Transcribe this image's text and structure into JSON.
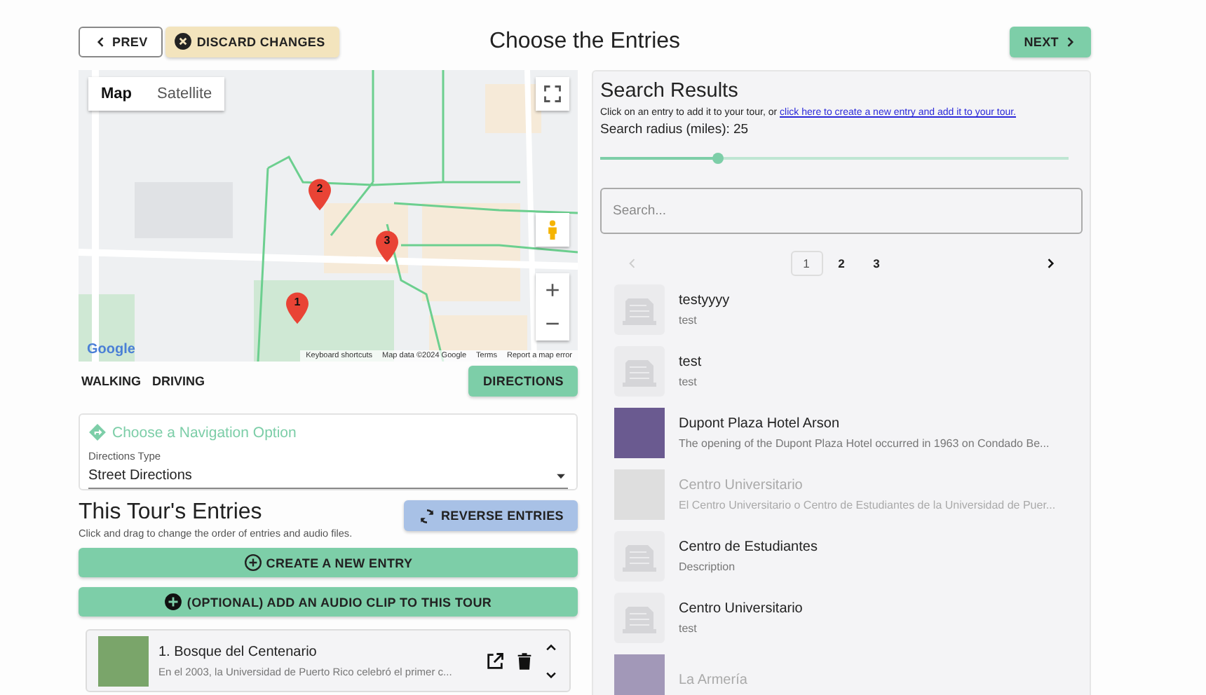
{
  "header": {
    "prev": "PREV",
    "discard": "DISCARD CHANGES",
    "title": "Choose the Entries",
    "next": "NEXT"
  },
  "map": {
    "types": [
      {
        "label": "Map",
        "selected": true
      },
      {
        "label": "Satellite",
        "selected": false
      }
    ],
    "markers": [
      "1",
      "2",
      "3"
    ],
    "zoom_in": "+",
    "zoom_out": "−",
    "logo": "Google",
    "attribution": [
      "Keyboard shortcuts",
      "Map data ©2024 Google",
      "Terms",
      "Report a map error"
    ]
  },
  "travel_modes": [
    "WALKING",
    "DRIVING"
  ],
  "directions_button": "DIRECTIONS",
  "navigation": {
    "title": "Choose a Navigation Option",
    "field_label": "Directions Type",
    "value": "Street Directions"
  },
  "entries_section": {
    "title": "This Tour's Entries",
    "hint": "Click and drag to change the order of entries and audio files.",
    "reverse": "REVERSE ENTRIES",
    "create": "CREATE A NEW ENTRY",
    "audio": "(OPTIONAL) ADD AN AUDIO CLIP TO THIS TOUR",
    "entries": [
      {
        "title": "1. Bosque del Centenario",
        "description": "En el 2003, la Universidad de Puerto Rico celebró el primer c..."
      }
    ]
  },
  "search_results": {
    "title": "Search Results",
    "intro": "Click on an entry to add it to your tour, or ",
    "link": "click here to create a new entry and add it to your tour.",
    "radius_label": "Search radius (miles): 25",
    "radius": {
      "level": 0.25
    },
    "placeholder": "Search...",
    "pages": [
      {
        "label": "1",
        "selected": true
      },
      {
        "label": "2",
        "selected": false
      },
      {
        "label": "3",
        "selected": false
      }
    ],
    "results": [
      {
        "kind": "placeholder",
        "title": "testyyyy",
        "description": "test",
        "dimmed": false
      },
      {
        "kind": "placeholder",
        "title": "test",
        "description": "test",
        "dimmed": false
      },
      {
        "kind": "photo",
        "title": "Dupont Plaza Hotel Arson",
        "description": "The opening of the Dupont Plaza Hotel occurred in 1963 on Condado Be...",
        "dimmed": false
      },
      {
        "kind": "photo",
        "title": "Centro Universitario",
        "description": "El Centro Universitario o Centro de Estudiantes de la Universidad de Puer...",
        "dimmed": true
      },
      {
        "kind": "placeholder",
        "title": "Centro de Estudiantes",
        "description": "Description",
        "dimmed": false
      },
      {
        "kind": "placeholder",
        "title": "Centro Universitario",
        "description": "test",
        "dimmed": false
      },
      {
        "kind": "photo",
        "title": "La Armería",
        "dimmed": true
      }
    ]
  }
}
